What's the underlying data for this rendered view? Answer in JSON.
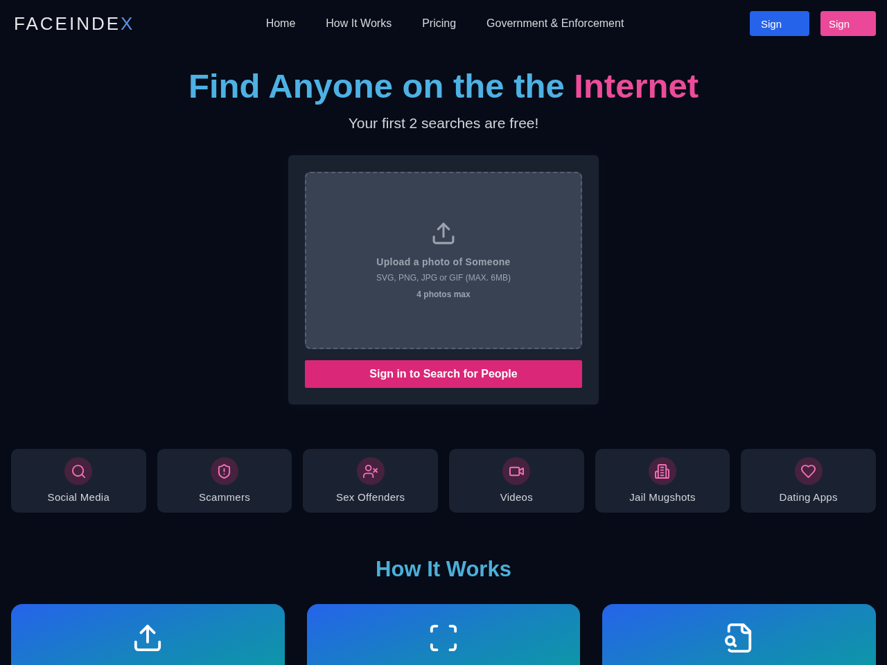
{
  "header": {
    "logo": {
      "text": "FACEINDE",
      "accent": "X"
    },
    "nav": [
      {
        "label": "Home"
      },
      {
        "label": "How It Works"
      },
      {
        "label": "Pricing"
      },
      {
        "label": "Government & Enforcement"
      }
    ],
    "buttons": [
      {
        "label": "Sign",
        "kind": "primary"
      },
      {
        "label": "Sign",
        "kind": "secondary"
      }
    ]
  },
  "hero": {
    "title": "Find Anyone on the the",
    "title_accent": "Internet",
    "subtitle": "Your first 2 searches are free!"
  },
  "upload": {
    "title": "Upload a photo of Someone",
    "formats": "SVG, PNG, JPG or GIF (MAX. 6MB)",
    "limit": "4 photos max",
    "button": "Sign in to Search for People"
  },
  "categories": [
    {
      "label": "Social Media",
      "kind": "search"
    },
    {
      "label": "Scammers",
      "kind": "shield"
    },
    {
      "label": "Sex Offenders",
      "kind": "userx"
    },
    {
      "label": "Videos",
      "kind": "video"
    },
    {
      "label": "Jail Mugshots",
      "kind": "building"
    },
    {
      "label": "Dating Apps",
      "kind": "heart"
    }
  ],
  "how_it_works": {
    "title": "How It Works",
    "steps": [
      {
        "kind": "upload"
      },
      {
        "kind": "scan"
      },
      {
        "kind": "filesearch"
      }
    ]
  }
}
